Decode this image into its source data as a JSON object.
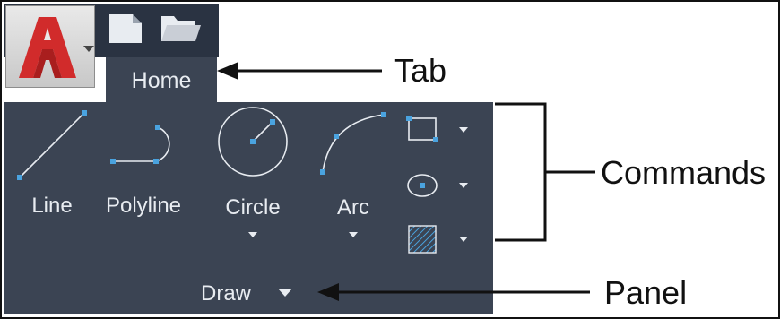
{
  "tab": {
    "label": "Home"
  },
  "commands": {
    "line": {
      "label": "Line",
      "icon": "line-icon"
    },
    "polyline": {
      "label": "Polyline",
      "icon": "polyline-icon"
    },
    "circle": {
      "label": "Circle",
      "icon": "circle-icon"
    },
    "arc": {
      "label": "Arc",
      "icon": "arc-icon"
    },
    "small": [
      {
        "icon": "rectangle-icon"
      },
      {
        "icon": "ellipse-icon"
      },
      {
        "icon": "hatch-icon"
      }
    ]
  },
  "panel": {
    "title": "Draw"
  },
  "annotations": {
    "tab": "Tab",
    "commands": "Commands",
    "panel": "Panel"
  },
  "colors": {
    "ribbon": "#3b4453",
    "title_strip": "#2a3342",
    "accent_blue": "#4aa3df",
    "logo_red": "#d12b2b"
  }
}
